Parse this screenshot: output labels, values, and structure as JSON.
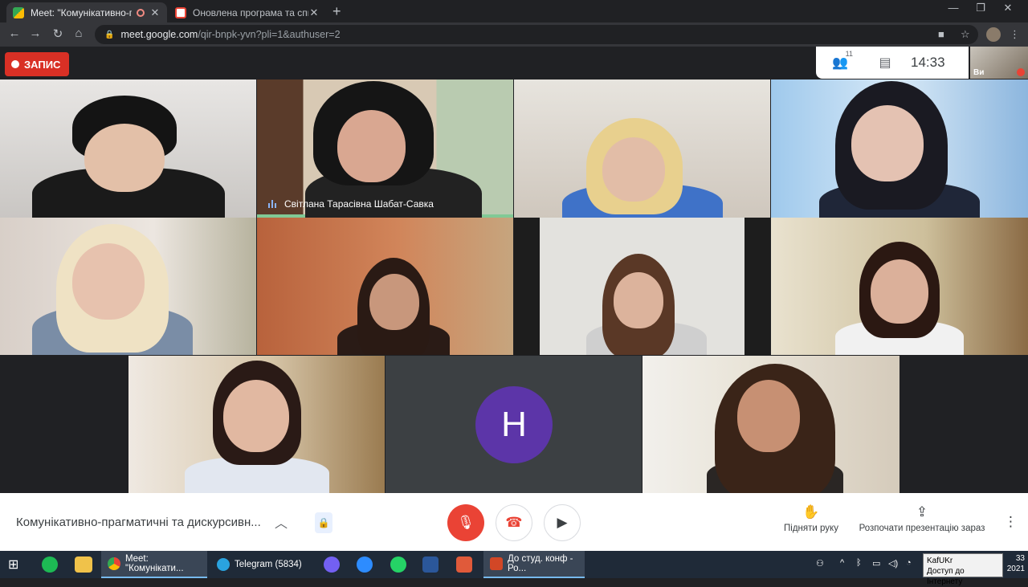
{
  "browser": {
    "tabs": [
      {
        "title": "Meet: \"Комунікативно-прагм",
        "active": true
      },
      {
        "title": "Оновлена програма та список",
        "active": false
      }
    ],
    "url_host": "meet.google.com",
    "url_path": "/qir-bnpk-yvn?pli=1&authuser=2"
  },
  "meet": {
    "recording_label": "ЗАПИС",
    "participants_count": "11",
    "time": "14:33",
    "self_label": "Ви",
    "speaker_name": "Світлана Тарасівна Шабат-Савка",
    "avatar_letter": "H",
    "meeting_title": "Комунікативно-прагматичні та дискурсивн...",
    "raise_hand_label": "Підняти руку",
    "present_label": "Розпочати презентацію зараз"
  },
  "taskbar": {
    "items": [
      {
        "label": "Meet: \"Комунікати..."
      },
      {
        "label": "Telegram (5834)"
      },
      {
        "label": "До студ. конф - Ро..."
      }
    ],
    "telegram_badge": "34",
    "tooltip_line1": "KafUKr",
    "tooltip_line2": "Доступ до Інтернету",
    "clock_time": "33",
    "clock_year": "2021"
  },
  "colors": {
    "recording": "#d93025",
    "avatar": "#5c35a8",
    "mic_off": "#ea4335"
  }
}
